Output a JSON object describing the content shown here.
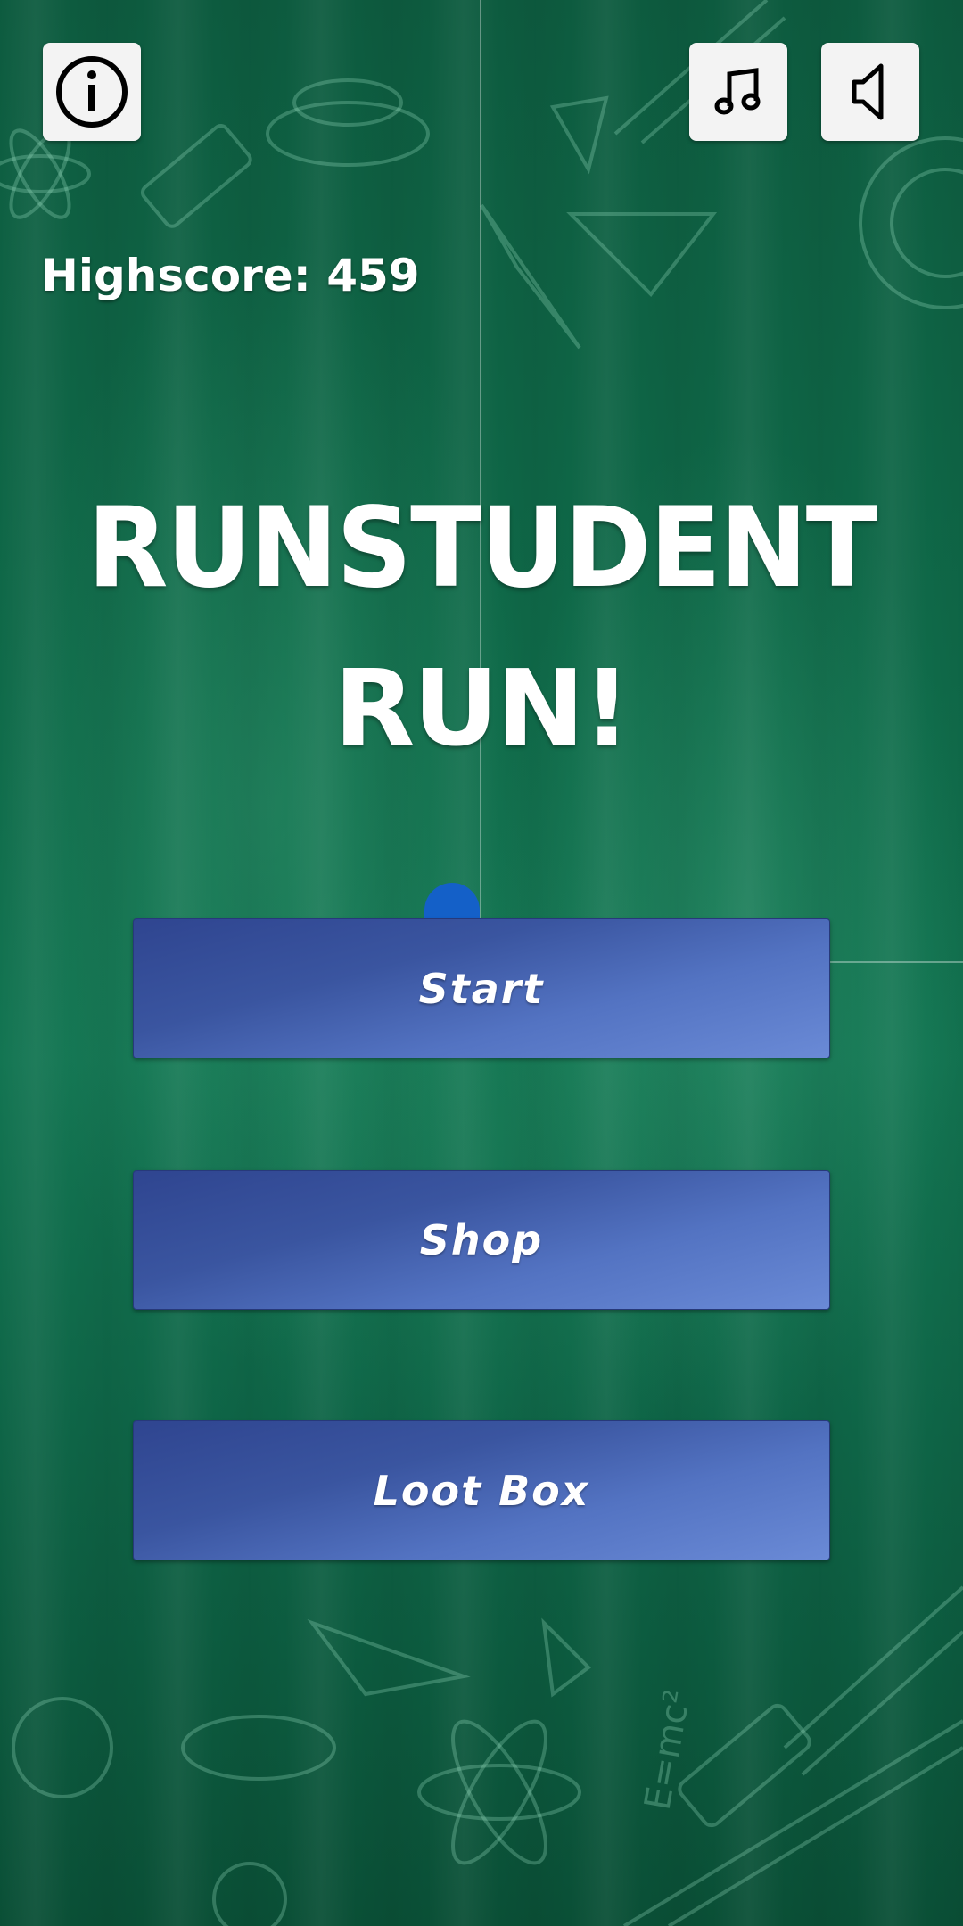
{
  "game": {
    "title_line1": "RUNSTUDENT",
    "title_line2": "RUN!"
  },
  "highscore": {
    "label": "Highscore:",
    "value": "459"
  },
  "top_bar": {
    "info_icon": "info-icon",
    "music_icon": "music-note-icon",
    "sound_icon": "speaker-icon"
  },
  "menu": {
    "start_label": "Start",
    "shop_label": "Shop",
    "lootbox_label": "Loot Box"
  },
  "colors": {
    "background": "#0b5a3c",
    "button": "#4a64b4",
    "text": "#ffffff",
    "marker_dot": "#1460c8"
  }
}
